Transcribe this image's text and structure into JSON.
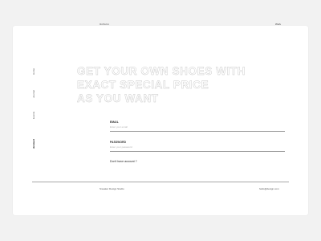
{
  "header": {
    "brand": "Uniform",
    "menu_link": "Work"
  },
  "side_nav": {
    "items": [
      {
        "label": "Home"
      },
      {
        "label": "Journal"
      },
      {
        "label": "Events"
      },
      {
        "label": "Account"
      }
    ]
  },
  "hero": {
    "lines": [
      "GET YOUR OWN SHOES WITH",
      "EXACT SPECIAL PRICE",
      "AS YOU WANT"
    ]
  },
  "form": {
    "email_label": "EMAIL",
    "email_placeholder": "Enter your email",
    "password_label": "PASSWORD",
    "password_placeholder": "Enter your password",
    "account_link": "Don't have account ?"
  },
  "footer": {
    "left_text": "Sneaker Design Studio",
    "right_text": "hello@design.com"
  }
}
